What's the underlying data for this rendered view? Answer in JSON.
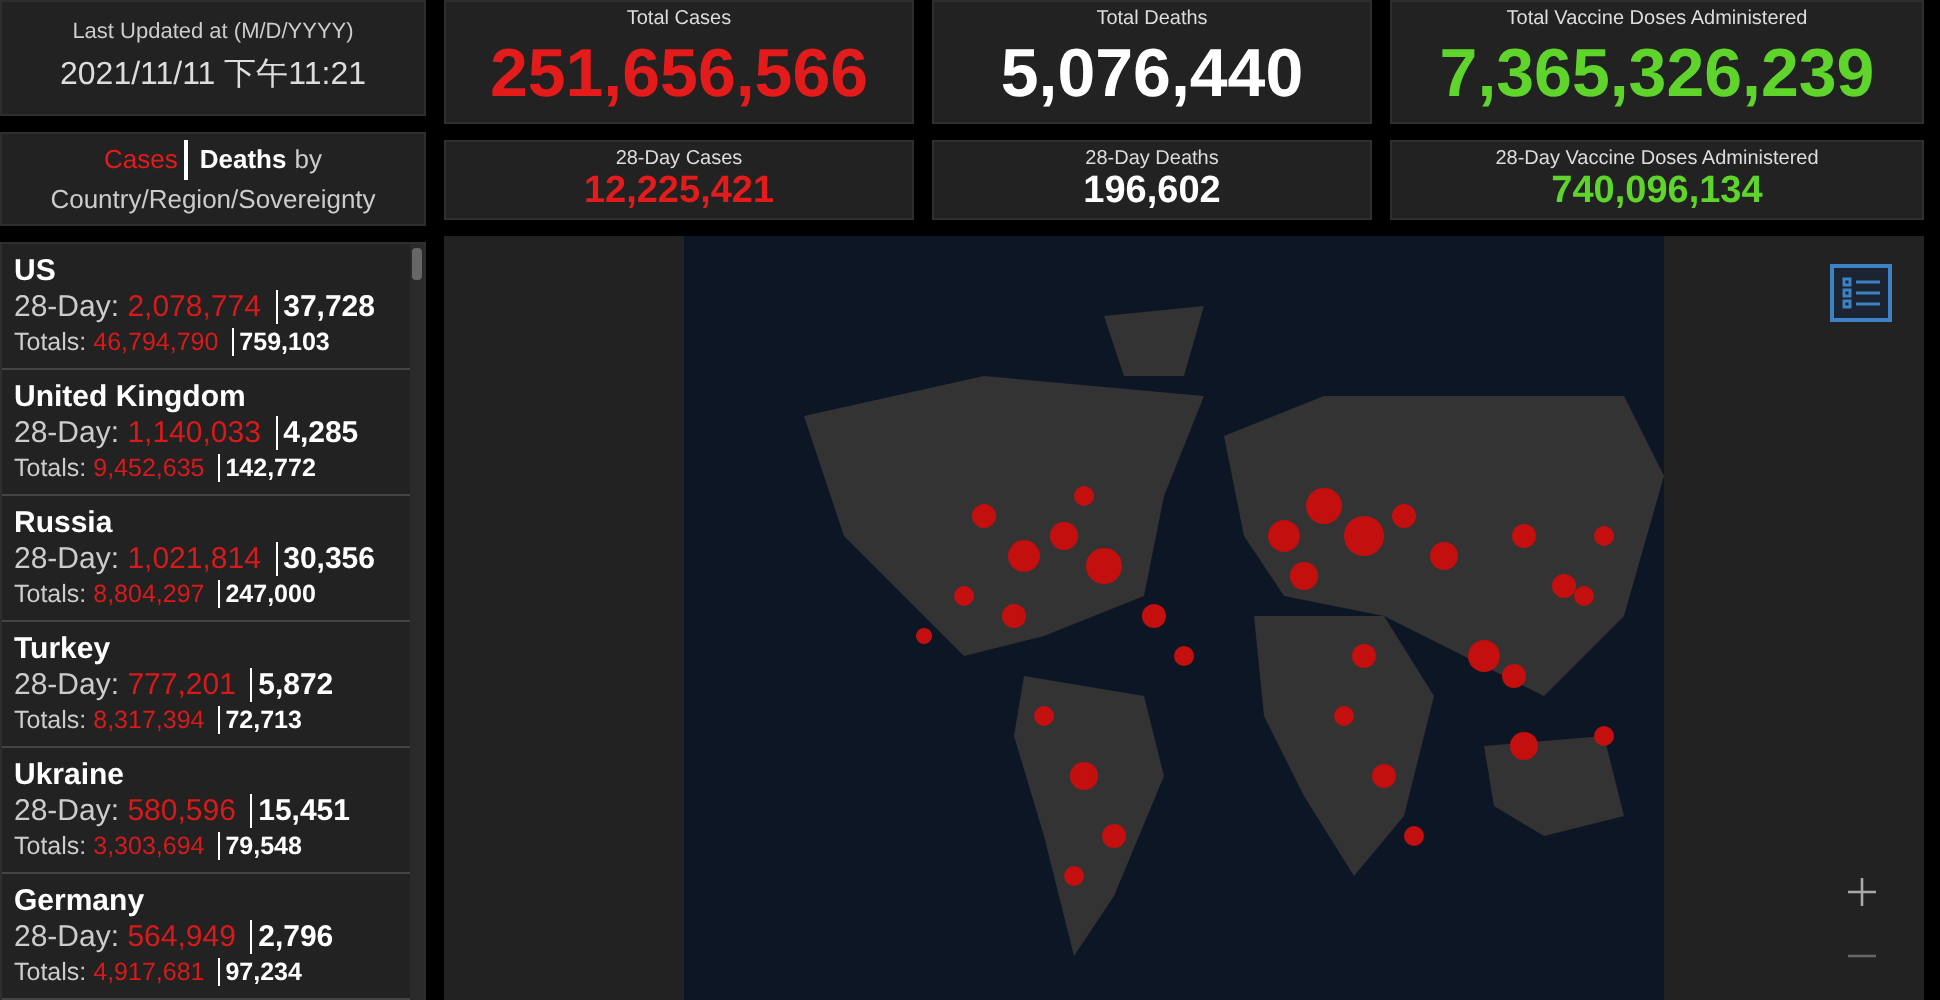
{
  "last_updated": {
    "label": "Last Updated at (M/D/YYYY)",
    "value": "2021/11/11 下午11:21"
  },
  "totals": [
    {
      "label": "Total Cases",
      "value": "251,656,566",
      "kind": "cases"
    },
    {
      "label": "Total Deaths",
      "value": "5,076,440",
      "kind": "deaths"
    },
    {
      "label": "Total Vaccine Doses Administered",
      "value": "7,365,326,239",
      "kind": "vaccines"
    }
  ],
  "recent": [
    {
      "label": "28-Day Cases",
      "value": "12,225,421",
      "kind": "cases"
    },
    {
      "label": "28-Day Deaths",
      "value": "196,602",
      "kind": "deaths"
    },
    {
      "label": "28-Day Vaccine Doses Administered",
      "value": "740,096,134",
      "kind": "vaccines"
    }
  ],
  "list_header": {
    "cases_tab": "Cases",
    "deaths_tab": "Deaths",
    "suffix": "by",
    "subtitle": "Country/Region/Sovereignty"
  },
  "countries": [
    {
      "name": "US",
      "day_label": "28-Day:",
      "day_cases": "2,078,774",
      "day_deaths": "37,728",
      "total_label": "Totals:",
      "total_cases": "46,794,790",
      "total_deaths": "759,103"
    },
    {
      "name": "United Kingdom",
      "day_label": "28-Day:",
      "day_cases": "1,140,033",
      "day_deaths": "4,285",
      "total_label": "Totals:",
      "total_cases": "9,452,635",
      "total_deaths": "142,772"
    },
    {
      "name": "Russia",
      "day_label": "28-Day:",
      "day_cases": "1,021,814",
      "day_deaths": "30,356",
      "total_label": "Totals:",
      "total_cases": "8,804,297",
      "total_deaths": "247,000"
    },
    {
      "name": "Turkey",
      "day_label": "28-Day:",
      "day_cases": "777,201",
      "day_deaths": "5,872",
      "total_label": "Totals:",
      "total_cases": "8,317,394",
      "total_deaths": "72,713"
    },
    {
      "name": "Ukraine",
      "day_label": "28-Day:",
      "day_cases": "580,596",
      "day_deaths": "15,451",
      "total_label": "Totals:",
      "total_cases": "3,303,694",
      "total_deaths": "79,548"
    },
    {
      "name": "Germany",
      "day_label": "28-Day:",
      "day_cases": "564,949",
      "day_deaths": "2,796",
      "total_label": "Totals:",
      "total_cases": "4,917,681",
      "total_deaths": "97,234"
    }
  ]
}
